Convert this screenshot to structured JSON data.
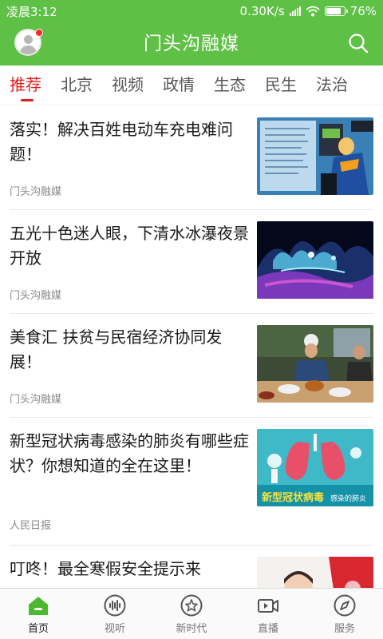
{
  "status": {
    "time": "凌晨3:12",
    "speed": "0.30K/s",
    "battery": "76%"
  },
  "app": {
    "title": "门头沟融媒"
  },
  "tabs": [
    {
      "label": "推荐",
      "active": true
    },
    {
      "label": "北京"
    },
    {
      "label": "视频"
    },
    {
      "label": "政情"
    },
    {
      "label": "生态"
    },
    {
      "label": "民生"
    },
    {
      "label": "法治"
    }
  ],
  "articles": [
    {
      "title": "落实！解决百姓电动车充电难问题！",
      "source": "门头沟融媒",
      "image": "ev-charging-photo"
    },
    {
      "title": "五光十色迷人眼，下清水冰瀑夜景开放",
      "source": "门头沟融媒",
      "image": "ice-waterfall-night-photo"
    },
    {
      "title": "美食汇 扶贫与民宿经济协同发展！",
      "source": "门头沟融媒",
      "image": "food-cooking-photo"
    },
    {
      "title": "新型冠状病毒感染的肺炎有哪些症状？你想知道的全在这里！",
      "source": "人民日报",
      "image": "pneumonia-infographic"
    },
    {
      "title": "叮咚！最全寒假安全提示来",
      "source": "",
      "image": "winter-cartoon-photo"
    }
  ],
  "thumb4_text": {
    "main": "新型冠状病毒",
    "sub": "感染的肺炎"
  },
  "nav": [
    {
      "label": "首页",
      "icon": "home-icon",
      "active": true
    },
    {
      "label": "视听",
      "icon": "audio-wave-icon"
    },
    {
      "label": "新时代",
      "icon": "star-circle-icon"
    },
    {
      "label": "直播",
      "icon": "video-camera-icon"
    },
    {
      "label": "服务",
      "icon": "compass-icon"
    }
  ],
  "colors": {
    "brand": "#5ec045",
    "active_tab": "#e31d1d",
    "nav_active": "#4cb832"
  }
}
